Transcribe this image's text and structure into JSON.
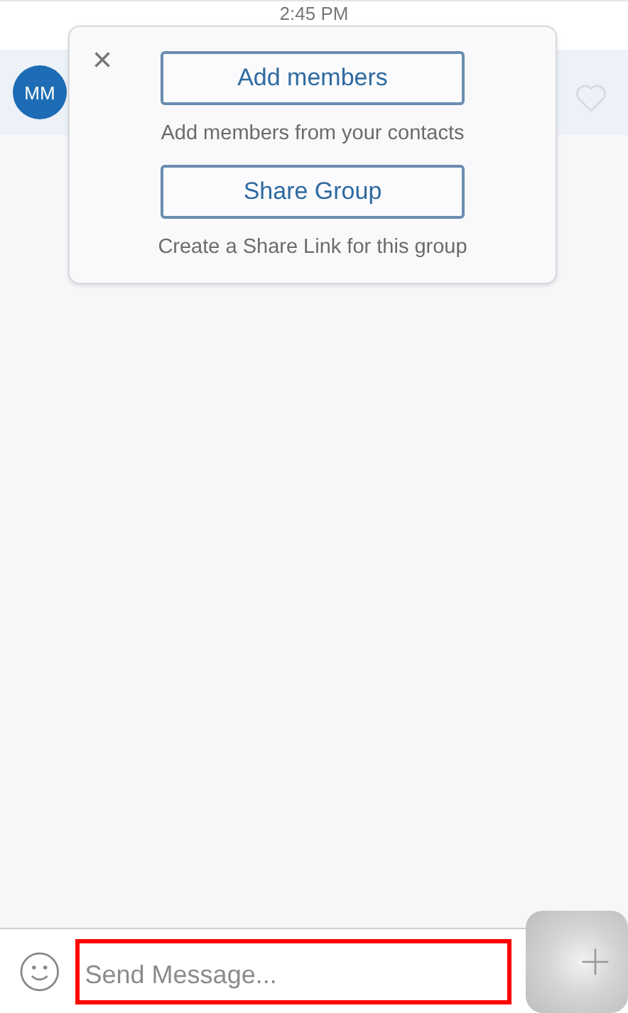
{
  "timestamp": "2:45 PM",
  "message": {
    "avatar_initials": "MM",
    "liked": false
  },
  "popup": {
    "close": "×",
    "actions": [
      {
        "label": "Add members",
        "description": "Add members from your contacts"
      },
      {
        "label": "Share Group",
        "description": "Create a Share Link for this group"
      }
    ]
  },
  "composer": {
    "placeholder": "Send Message...",
    "highlighted": true
  }
}
